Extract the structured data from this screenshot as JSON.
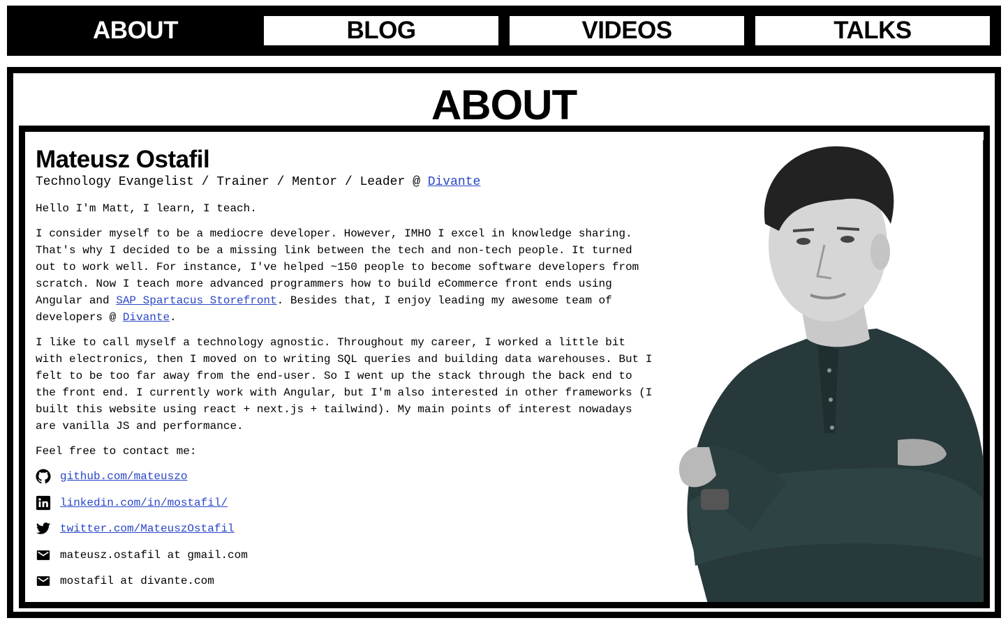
{
  "nav": {
    "items": [
      {
        "label": "ABOUT",
        "active": true
      },
      {
        "label": "BLOG",
        "active": false
      },
      {
        "label": "VIDEOS",
        "active": false
      },
      {
        "label": "TALKS",
        "active": false
      }
    ]
  },
  "page": {
    "title": "ABOUT"
  },
  "profile": {
    "name": "Mateusz Ostafil",
    "subtitle_prefix": "Technology Evangelist / Trainer / Mentor / Leader @ ",
    "subtitle_link": "Divante",
    "intro": "Hello I'm Matt, I learn, I teach.",
    "para1_a": "I consider myself to be a mediocre developer. However, IMHO I excel in knowledge sharing. That's why I decided to be a missing link between the tech and non-tech people. It turned out to work well. For instance, I've helped ~150 people to become software developers from scratch. Now I teach more advanced programmers how to build eCommerce front ends using Angular and ",
    "para1_link1": "SAP Spartacus Storefront",
    "para1_b": ". Besides that, I enjoy leading my awesome team of developers @ ",
    "para1_link2": "Divante",
    "para1_c": ".",
    "para2": "I like to call myself a technology agnostic. Throughout my career, I worked a little bit with electronics, then I moved on to writing SQL queries and building data warehouses. But I felt to be too far away from the end-user. So I went up the stack through the back end to the front end. I currently work with Angular, but I'm also interested in other frameworks (I built this website using react + next.js + tailwind). My main points of interest nowadays are vanilla JS and performance.",
    "contact_intro": "Feel free to contact me:"
  },
  "contacts": [
    {
      "icon": "github-icon",
      "text": "github.com/mateuszo",
      "link": true
    },
    {
      "icon": "linkedin-icon",
      "text": "linkedin.com/in/mostafil/",
      "link": true
    },
    {
      "icon": "twitter-icon",
      "text": "twitter.com/MateuszOstafil",
      "link": true
    },
    {
      "icon": "mail-icon",
      "text": "mateusz.ostafil at gmail.com",
      "link": false
    },
    {
      "icon": "mail-icon",
      "text": "mostafil at divante.com",
      "link": false
    }
  ],
  "colors": {
    "link": "#2946c7",
    "border": "#000000",
    "background": "#ffffff"
  }
}
